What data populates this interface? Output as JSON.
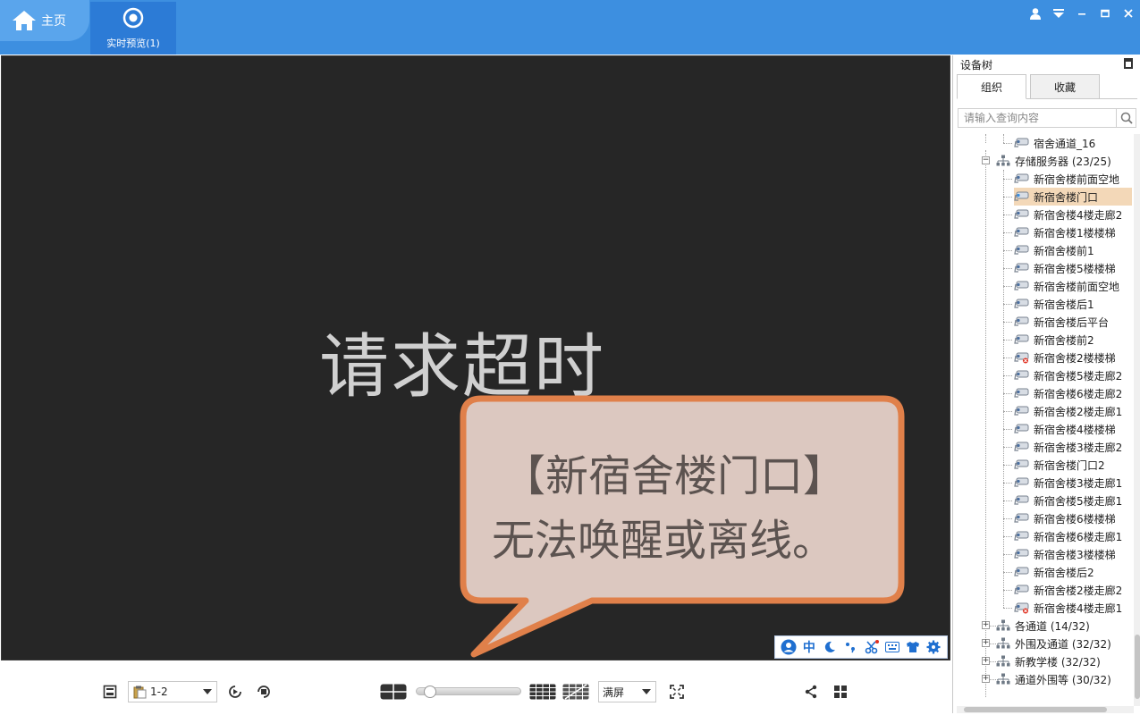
{
  "titlebar": {
    "home_label": "主页",
    "live_tab_label": "实时预览(1)"
  },
  "video": {
    "status_text": "请求超时",
    "bubble_line1": "【新宿舍楼门口】",
    "bubble_line2": "无法唤醒或离线。"
  },
  "ime_bar": {
    "lang_glyph": "中"
  },
  "toolbar": {
    "page_select": "1-2",
    "screen_mode": "满屏"
  },
  "panel": {
    "title": "设备树",
    "tabs": [
      "组织",
      "收藏"
    ],
    "search_placeholder": "请输入查询内容"
  },
  "tree": {
    "top_item": "宿舍通道_16",
    "storage_group": "存储服务器 (23/25)",
    "cameras": [
      {
        "label": "新宿舍楼前面空地",
        "status": "online"
      },
      {
        "label": "新宿舍楼门口",
        "status": "online",
        "selected": true
      },
      {
        "label": "新宿舍楼4楼走廊2",
        "status": "online"
      },
      {
        "label": "新宿舍楼1楼楼梯",
        "status": "online"
      },
      {
        "label": "新宿舍楼前1",
        "status": "online"
      },
      {
        "label": "新宿舍楼5楼楼梯",
        "status": "online"
      },
      {
        "label": "新宿舍楼前面空地",
        "status": "online"
      },
      {
        "label": "新宿舍楼后1",
        "status": "online"
      },
      {
        "label": "新宿舍楼后平台",
        "status": "online"
      },
      {
        "label": "新宿舍楼前2",
        "status": "online"
      },
      {
        "label": "新宿舍楼2楼楼梯",
        "status": "offline"
      },
      {
        "label": "新宿舍楼5楼走廊2",
        "status": "online"
      },
      {
        "label": "新宿舍楼6楼走廊2",
        "status": "online"
      },
      {
        "label": "新宿舍楼2楼走廊1",
        "status": "online"
      },
      {
        "label": "新宿舍楼4楼楼梯",
        "status": "online"
      },
      {
        "label": "新宿舍楼3楼走廊2",
        "status": "online"
      },
      {
        "label": "新宿舍楼门口2",
        "status": "online"
      },
      {
        "label": "新宿舍楼3楼走廊1",
        "status": "online"
      },
      {
        "label": "新宿舍楼5楼走廊1",
        "status": "online"
      },
      {
        "label": "新宿舍楼6楼楼梯",
        "status": "online"
      },
      {
        "label": "新宿舍楼6楼走廊1",
        "status": "online"
      },
      {
        "label": "新宿舍楼3楼楼梯",
        "status": "online"
      },
      {
        "label": "新宿舍楼后2",
        "status": "online"
      },
      {
        "label": "新宿舍楼2楼走廊2",
        "status": "online"
      },
      {
        "label": "新宿舍楼4楼走廊1",
        "status": "offline"
      }
    ],
    "groups": [
      {
        "label": "各通道 (14/32)"
      },
      {
        "label": "外围及通道 (32/32)"
      },
      {
        "label": "新教学楼 (32/32)"
      },
      {
        "label": "通道外围等 (30/32)"
      }
    ]
  }
}
